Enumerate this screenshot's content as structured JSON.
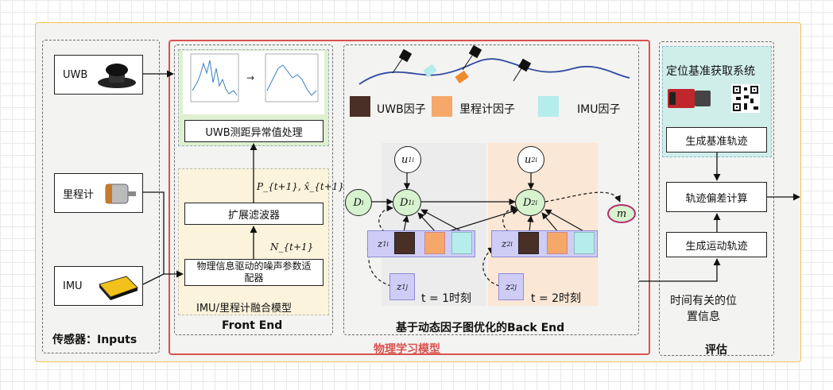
{
  "sensors": {
    "title": "传感器：Inputs",
    "uwb": "UWB",
    "odometer": "里程计",
    "imu": "IMU"
  },
  "physics_model": {
    "title": "物理学习模型"
  },
  "front_end": {
    "title": "Front End",
    "uwb_processing": "UWB测距异常值处理",
    "ekf": "扩展滤波器",
    "noise_adapter": "物理信息驱动的噪声参数适配器",
    "fusion_title": "IMU/里程计融合模型",
    "arrow_label_top": "P_{t+1}, x̂_{t+1}",
    "arrow_label_bottom": "N_{t+1}"
  },
  "back_end": {
    "title": "基于动态因子图优化的Back End",
    "legend_uwb": "UWB因子",
    "legend_odom": "里程计因子",
    "legend_imu": "IMU因子",
    "time1": "t = 1时刻",
    "time2": "t = 2时刻",
    "nodes": {
      "u1": "u",
      "u2": "u",
      "d0": "D",
      "d1": "D",
      "d2": "D",
      "m": "m",
      "z1": "z",
      "z2": "z",
      "zj1": "z",
      "zj2": "z"
    }
  },
  "evaluation": {
    "title": "评估",
    "ref_system": "定位基准获取系统",
    "gen_ref": "生成基准轨迹",
    "traj_error": "轨迹偏差计算",
    "gen_motion": "生成运动轨迹",
    "time_info": "时间有关的位置信息"
  },
  "colors": {
    "uwb_factor": "#4a2f27",
    "odom_factor": "#f5a86a",
    "imu_factor": "#b5ecec",
    "physics_border": "#d9534f",
    "title_red": "#d9534f"
  }
}
